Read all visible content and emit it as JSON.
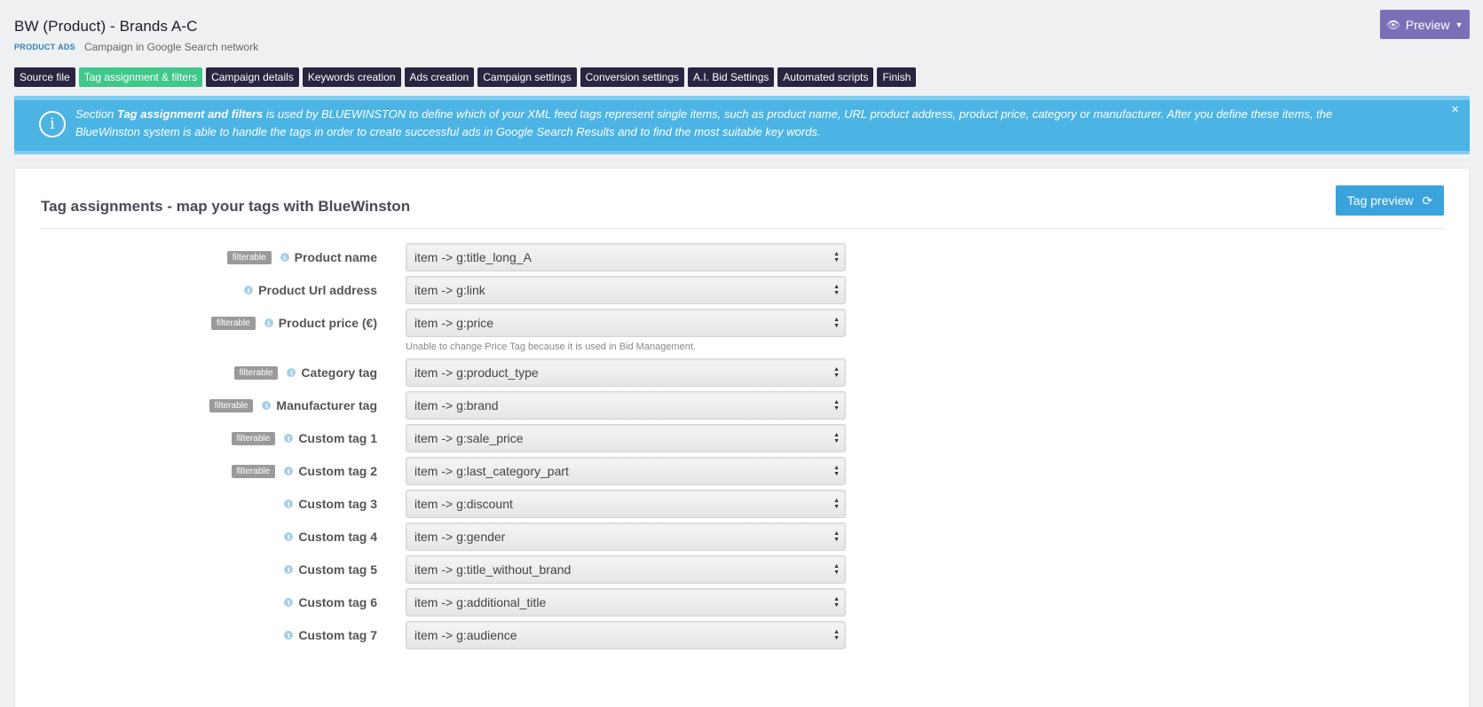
{
  "header": {
    "title": "BW (Product) - Brands A-C",
    "badge": "PRODUCT ADS",
    "subtitle": "Campaign in Google Search network"
  },
  "preview_button": {
    "label": "Preview"
  },
  "tabs": [
    {
      "label": "Source file",
      "active": false
    },
    {
      "label": "Tag assignment & filters",
      "active": true
    },
    {
      "label": "Campaign details",
      "active": false
    },
    {
      "label": "Keywords creation",
      "active": false
    },
    {
      "label": "Ads creation",
      "active": false
    },
    {
      "label": "Campaign settings",
      "active": false
    },
    {
      "label": "Conversion settings",
      "active": false
    },
    {
      "label": "A.I. Bid Settings",
      "active": false
    },
    {
      "label": "Automated scripts",
      "active": false
    },
    {
      "label": "Finish",
      "active": false
    }
  ],
  "banner": {
    "prefix": "Section ",
    "section_name": "Tag assignment and filters",
    "text": " is used by BLUEWINSTON to define which of your XML feed tags represent single items, such as product name, URL product address, product price, category or manufacturer. After you define these items, the BlueWinston system is able to handle the tags in order to create successful ads in Google Search Results and to find the most suitable key words.",
    "close": "×"
  },
  "panel": {
    "title": "Tag assignments - map your tags with BlueWinston",
    "tag_preview_label": "Tag preview",
    "filterable_label": "filterable",
    "price_help": "Unable to change Price Tag because it is used in Bid Management."
  },
  "rows": [
    {
      "label": "Product name",
      "filterable": true,
      "value": "item -> g:title_long_A"
    },
    {
      "label": "Product Url address",
      "filterable": false,
      "value": "item -> g:link"
    },
    {
      "label": "Product price (€)",
      "filterable": true,
      "value": "item -> g:price"
    },
    {
      "label": "Category tag",
      "filterable": true,
      "value": "item -> g:product_type"
    },
    {
      "label": "Manufacturer tag",
      "filterable": true,
      "value": "item -> g:brand"
    },
    {
      "label": "Custom tag 1",
      "filterable": true,
      "value": "item -> g:sale_price"
    },
    {
      "label": "Custom tag 2",
      "filterable": true,
      "value": "item -> g:last_category_part"
    },
    {
      "label": "Custom tag 3",
      "filterable": false,
      "value": "item -> g:discount"
    },
    {
      "label": "Custom tag 4",
      "filterable": false,
      "value": "item -> g:gender"
    },
    {
      "label": "Custom tag 5",
      "filterable": false,
      "value": "item -> g:title_without_brand"
    },
    {
      "label": "Custom tag 6",
      "filterable": false,
      "value": "item -> g:additional_title"
    },
    {
      "label": "Custom tag 7",
      "filterable": false,
      "value": "item -> g:audience"
    }
  ],
  "icons": {
    "preview": "eye-icon",
    "preview_caret": "caret-down-icon",
    "info": "info-circle-icon",
    "refresh": "refresh-icon",
    "row_info": "info-icon",
    "select_arrows": "select-arrows-icon"
  },
  "colors": {
    "tab_bg": "#2a2440",
    "tab_active": "#40c78a",
    "banner": "#4bb4e4",
    "preview_btn": "#7b6fb8",
    "tag_preview_btn": "#3aa3dc"
  }
}
